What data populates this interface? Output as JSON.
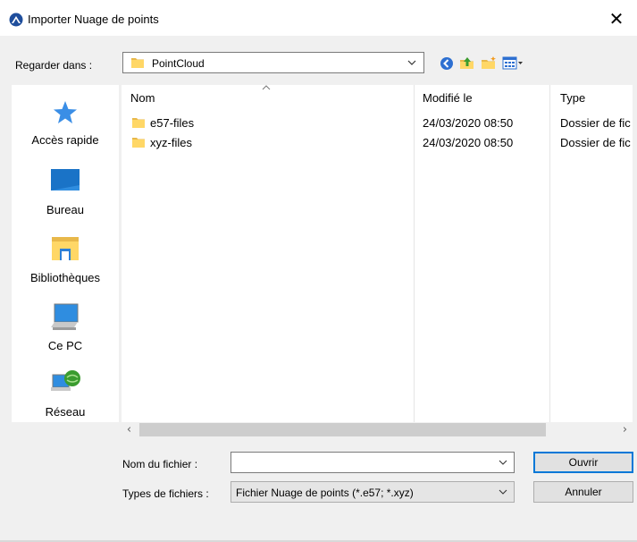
{
  "window": {
    "title": "Importer Nuage de points",
    "close_symbol": "✕"
  },
  "lookin": {
    "label": "Regarder dans :",
    "value": "PointCloud"
  },
  "toolbar": {
    "icons": [
      "back-icon",
      "up-folder-icon",
      "new-folder-icon",
      "view-menu-icon"
    ]
  },
  "places": [
    {
      "label": "Accès rapide",
      "icon": "star-icon"
    },
    {
      "label": "Bureau",
      "icon": "desktop-icon"
    },
    {
      "label": "Bibliothèques",
      "icon": "libraries-icon"
    },
    {
      "label": "Ce PC",
      "icon": "computer-icon"
    },
    {
      "label": "Réseau",
      "icon": "network-icon"
    }
  ],
  "filelist": {
    "columns": [
      "Nom",
      "Modifié le",
      "Type"
    ],
    "rows": [
      {
        "name": "e57-files",
        "modified": "24/03/2020 08:50",
        "type": "Dossier de fic"
      },
      {
        "name": "xyz-files",
        "modified": "24/03/2020 08:50",
        "type": "Dossier de fic"
      }
    ]
  },
  "form": {
    "filename_label": "Nom du fichier :",
    "filename_value": "",
    "filetype_label": "Types de fichiers :",
    "filetype_value": "Fichier Nuage de points (*.e57; *.xyz)",
    "open_label": "Ouvrir",
    "cancel_label": "Annuler"
  },
  "colors": {
    "folder": "#ffd766",
    "accent": "#0078d7"
  }
}
